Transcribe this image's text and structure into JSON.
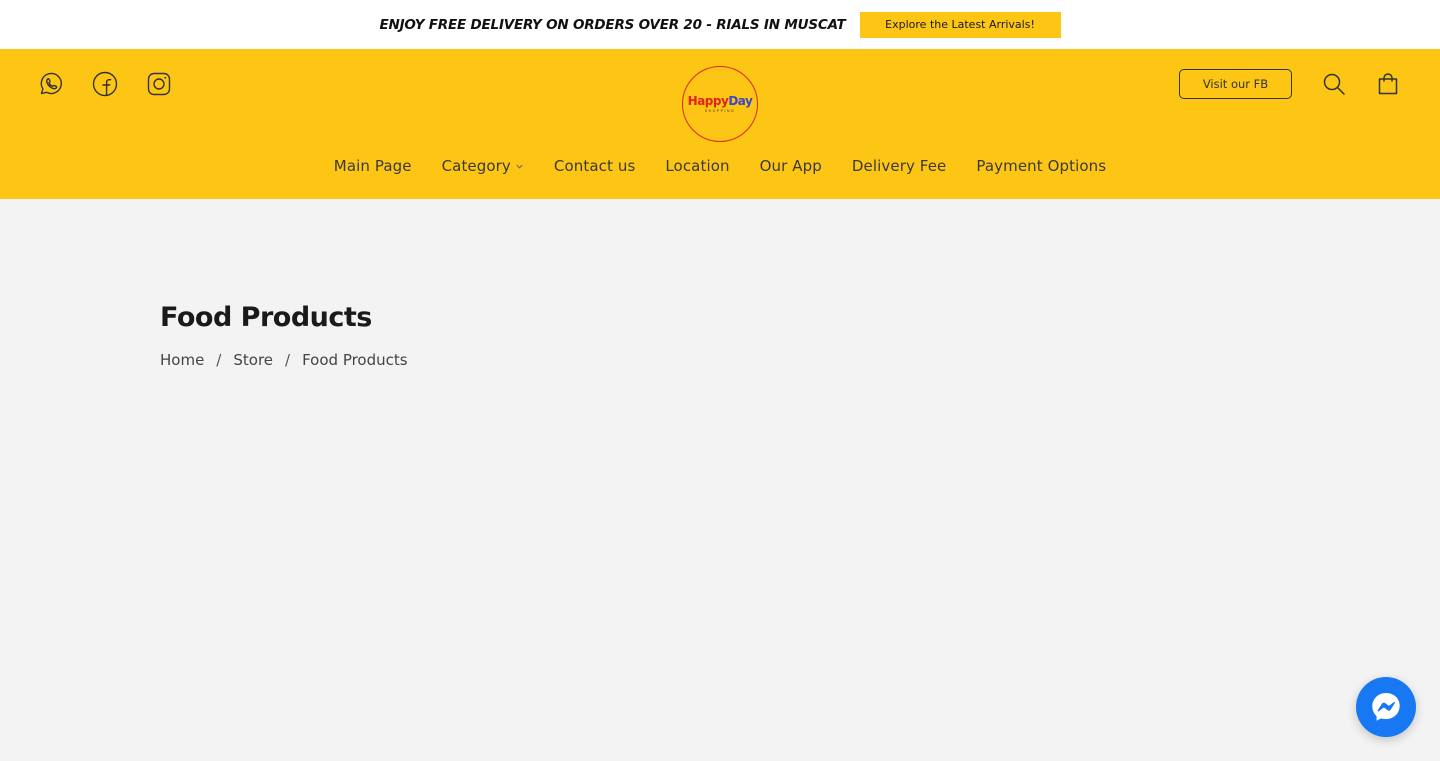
{
  "announcement": {
    "text": "ENJOY FREE DELIVERY ON ORDERS OVER 20 - RIALS IN MUSCAT",
    "button_label": "Explore the Latest Arrivals!"
  },
  "header": {
    "social_icons": [
      "whatsapp-icon",
      "facebook-icon",
      "instagram-icon"
    ],
    "logo": {
      "happy": "Happy",
      "day": "Day",
      "sub": "SHOPPING"
    },
    "fb_button_label": "Visit our FB",
    "tool_icons": [
      "search-icon",
      "shopping-bag-icon"
    ]
  },
  "nav": {
    "items": [
      {
        "label": "Main Page"
      },
      {
        "label": "Category"
      },
      {
        "label": "Contact us"
      },
      {
        "label": "Location"
      },
      {
        "label": "Our App"
      },
      {
        "label": "Delivery Fee"
      },
      {
        "label": "Payment Options"
      }
    ]
  },
  "page": {
    "title": "Food Products",
    "breadcrumb": [
      "Home",
      "Store",
      "Food Products"
    ],
    "separator": "/"
  },
  "colors": {
    "brand_yellow": "#fdc615",
    "messenger_blue": "#1877f2",
    "logo_red": "#e0241c",
    "logo_blue": "#3a47c9"
  }
}
